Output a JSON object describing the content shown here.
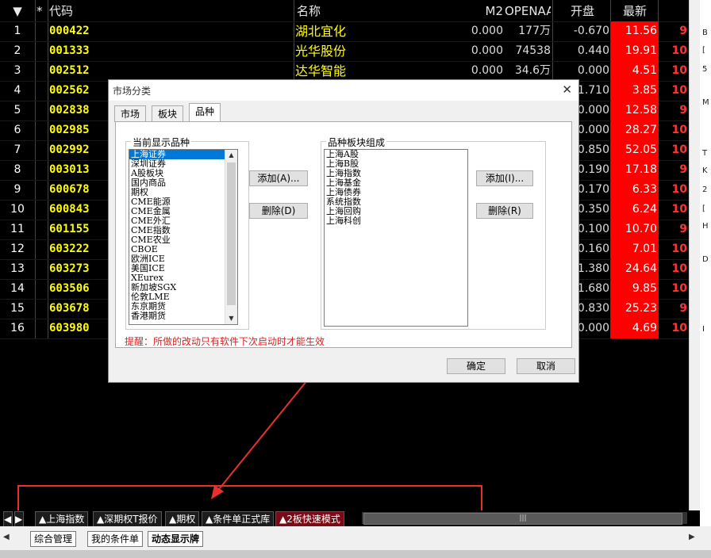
{
  "header": {
    "sort_icon": "▼",
    "star": "*",
    "code": "代码",
    "name": "名称",
    "m2": "M2",
    "openaa": "OPENAA",
    "open": "开盘",
    "last": "最新"
  },
  "rows": [
    {
      "idx": "1",
      "code": "000422",
      "name": "湖北宜化",
      "m2": "0.000",
      "openaa": "177万",
      "open": "-0.670",
      "last": "11.56",
      "x": "9"
    },
    {
      "idx": "2",
      "code": "001333",
      "name": "光华股份",
      "m2": "0.000",
      "openaa": "74538",
      "open": "0.440",
      "last": "19.91",
      "x": "10"
    },
    {
      "idx": "3",
      "code": "002512",
      "name": "达华智能",
      "m2": "0.000",
      "openaa": "34.6万",
      "open": "0.000",
      "last": "4.51",
      "x": "10"
    },
    {
      "idx": "4",
      "code": "002562",
      "name": "",
      "m2": "",
      "openaa": "",
      "open": "1.710",
      "last": "3.85",
      "x": "10"
    },
    {
      "idx": "5",
      "code": "002838",
      "name": "",
      "m2": "",
      "openaa": "",
      "open": "0.000",
      "last": "12.58",
      "x": "9"
    },
    {
      "idx": "6",
      "code": "002985",
      "name": "",
      "m2": "",
      "openaa": "",
      "open": "0.000",
      "last": "28.27",
      "x": "10"
    },
    {
      "idx": "7",
      "code": "002992",
      "name": "",
      "m2": "",
      "openaa": "",
      "open": "0.850",
      "last": "52.05",
      "x": "10"
    },
    {
      "idx": "8",
      "code": "003013",
      "name": "",
      "m2": "",
      "openaa": "",
      "open": "-0.190",
      "last": "17.18",
      "x": "9"
    },
    {
      "idx": "9",
      "code": "600678",
      "name": "",
      "m2": "",
      "openaa": "",
      "open": "0.170",
      "last": "6.33",
      "x": "10"
    },
    {
      "idx": "10",
      "code": "600843",
      "name": "",
      "m2": "",
      "openaa": "",
      "open": "0.350",
      "last": "6.24",
      "x": "10"
    },
    {
      "idx": "11",
      "code": "601155",
      "name": "",
      "m2": "",
      "openaa": "",
      "open": "0.100",
      "last": "10.70",
      "x": "9"
    },
    {
      "idx": "12",
      "code": "603222",
      "name": "",
      "m2": "",
      "openaa": "",
      "open": "-0.160",
      "last": "7.01",
      "x": "10"
    },
    {
      "idx": "13",
      "code": "603273",
      "name": "",
      "m2": "",
      "openaa": "",
      "open": "1.380",
      "last": "24.64",
      "x": "10"
    },
    {
      "idx": "14",
      "code": "603506",
      "name": "",
      "m2": "",
      "openaa": "",
      "open": "-1.680",
      "last": "9.85",
      "x": "10"
    },
    {
      "idx": "15",
      "code": "603678",
      "name": "",
      "m2": "",
      "openaa": "",
      "open": "0.830",
      "last": "25.23",
      "x": "9"
    },
    {
      "idx": "16",
      "code": "603980",
      "name": "",
      "m2": "",
      "openaa": "",
      "open": "0.000",
      "last": "4.69",
      "x": "10"
    }
  ],
  "right_edge": [
    "B",
    "[",
    "5",
    "M",
    "T",
    "K",
    "2",
    "[",
    "H",
    "D",
    "I"
  ],
  "sheet_tabs": [
    "▲上海指数",
    "▲深期权T报价",
    "▲期权",
    "▲条件单正式库",
    "▲2板快速模式"
  ],
  "sheet_scroll": "|||",
  "bottom_tabs": [
    "综合管理",
    "我的条件单",
    "动态显示牌"
  ],
  "dialog": {
    "title": "市场分类",
    "close": "✕",
    "tabs": [
      "市场",
      "板块",
      "品种"
    ],
    "left_group": "当前显示品种",
    "left_items": [
      "上海证券",
      "深圳证券",
      "A股板块",
      "国内商品",
      "期权",
      "CME能源",
      "CME金属",
      "CME外汇",
      "CME指数",
      "CME农业",
      "CBOE",
      "欧洲ICE",
      "美国ICE",
      "XEurex",
      "新加坡SGX",
      "伦敦LME",
      "东京期货",
      "香港期货"
    ],
    "right_group": "品种板块组成",
    "right_items": [
      "上海A股",
      "上海B股",
      "上海指数",
      "上海基金",
      "上海债券",
      "系统指数",
      "上海回购",
      "上海科创"
    ],
    "add1": "添加(A)...",
    "del1": "删除(D)",
    "add2": "添加(I)...",
    "del2": "删除(R)",
    "hint": "提醒：所做的改动只有软件下次启动时才能生效",
    "ok": "确定",
    "cancel": "取消"
  },
  "colors": {
    "highlight_red": "#ff0000",
    "code_yellow": "#ffff00",
    "annotation": "#e8312f"
  }
}
